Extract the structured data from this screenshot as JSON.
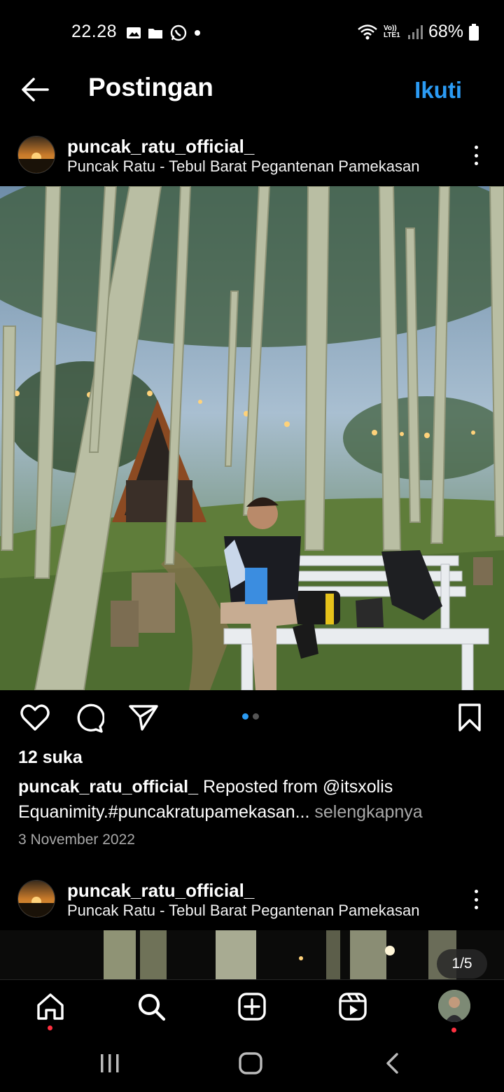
{
  "status_bar": {
    "time": "22.28",
    "left_icons": [
      "gallery-icon",
      "folder-icon",
      "whatsapp-icon",
      "dot-icon"
    ],
    "right_icons": [
      "wifi-icon",
      "volte-lte-icon",
      "signal-icon"
    ],
    "volte_label": "Vo)) LTE1",
    "battery": "68%"
  },
  "header": {
    "title": "Postingan",
    "follow_label": "Ikuti"
  },
  "post1": {
    "username": "puncak_ratu_official_",
    "location": "Puncak Ratu - Tebul Barat Pegantenan Pamekasan",
    "likes": "12 suka",
    "caption_user": "puncak_ratu_official_",
    "caption_line1": "Reposted from @itsxolis",
    "caption_line2": "Equanimity.#puncakratupamekasan...",
    "more_label": "selengkapnya",
    "date": "3 November 2022",
    "carousel_active": 0,
    "carousel_total": 2
  },
  "post2": {
    "username": "puncak_ratu_official_",
    "location": "Puncak Ratu - Tebul Barat Pegantenan Pamekasan",
    "counter": "1/5"
  },
  "bottom_nav": [
    "home-icon",
    "search-icon",
    "create-icon",
    "reels-icon",
    "profile-avatar"
  ],
  "colors": {
    "accent": "#2b9bf4",
    "background": "#000000",
    "notification": "#ff3040"
  }
}
